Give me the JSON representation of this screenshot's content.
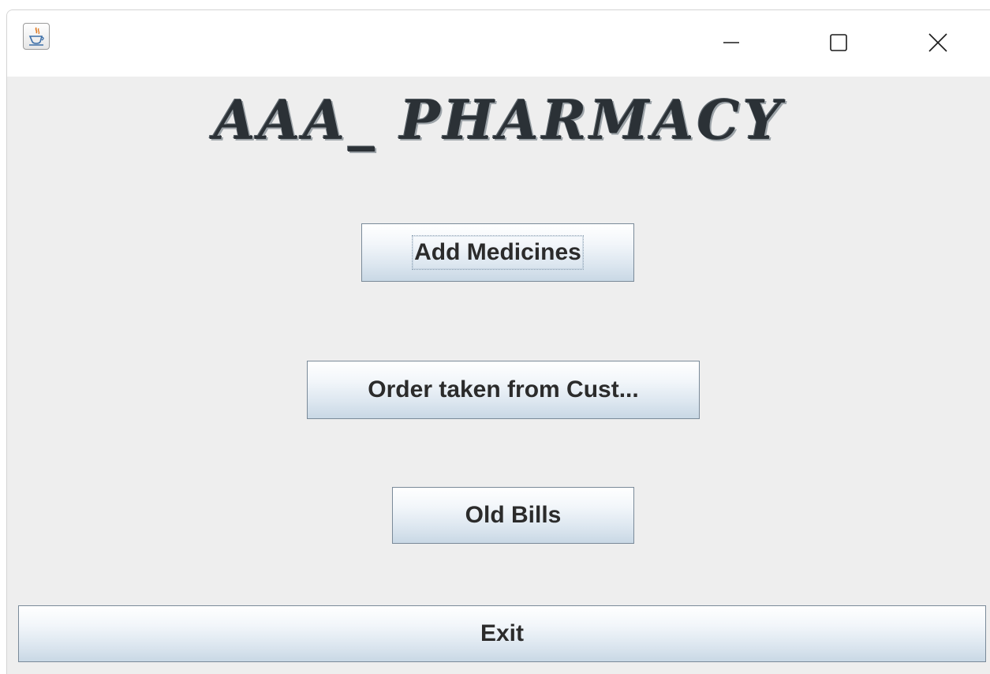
{
  "window": {
    "app_icon": "java-coffee-cup-icon",
    "controls": {
      "minimize_icon": "minimize-icon",
      "maximize_icon": "maximize-icon",
      "close_icon": "close-icon"
    }
  },
  "heading": "AAA_ PHARMACY",
  "buttons": {
    "add_medicines": "Add Medicines",
    "order_taken": "Order taken from Cust...",
    "old_bills": "Old Bills",
    "exit": "Exit"
  },
  "colors": {
    "background": "#eeeeee",
    "button_border": "#7a8a99",
    "heading_text": "#2b3136"
  }
}
